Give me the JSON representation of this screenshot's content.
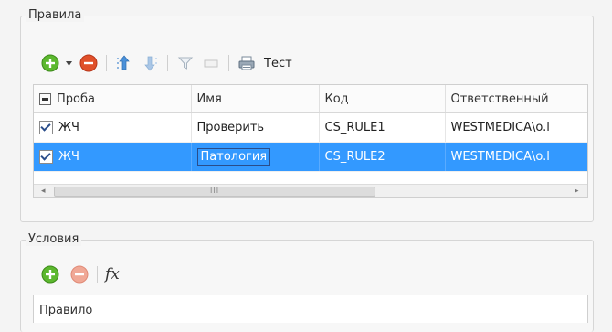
{
  "rules_group": {
    "title": "Правила",
    "toolbar": {
      "test_label": "Тест"
    },
    "columns": [
      "Проба",
      "Имя",
      "Код",
      "Ответственный"
    ],
    "rows": [
      {
        "checked": true,
        "probe": "ЖЧ",
        "name": "Проверить",
        "code": "CS_RULE1",
        "responsible": "WESTMEDICA\\o.l"
      },
      {
        "checked": true,
        "probe": "ЖЧ",
        "name": "Патология",
        "code": "CS_RULE2",
        "responsible": "WESTMEDICA\\o.l",
        "selected": true
      }
    ],
    "scroll_grip": "III"
  },
  "conditions_group": {
    "title": "Условия",
    "fx_label": "fx",
    "list_header": "Правило"
  },
  "colors": {
    "selection": "#3399ff",
    "add_green": "#5cb82e",
    "remove_red": "#e0502a"
  },
  "icons": [
    "add-icon",
    "dropdown-arrow-icon",
    "remove-icon",
    "move-up-icon",
    "move-down-icon",
    "filter-icon",
    "rectangle-icon",
    "print-icon",
    "function-icon"
  ]
}
